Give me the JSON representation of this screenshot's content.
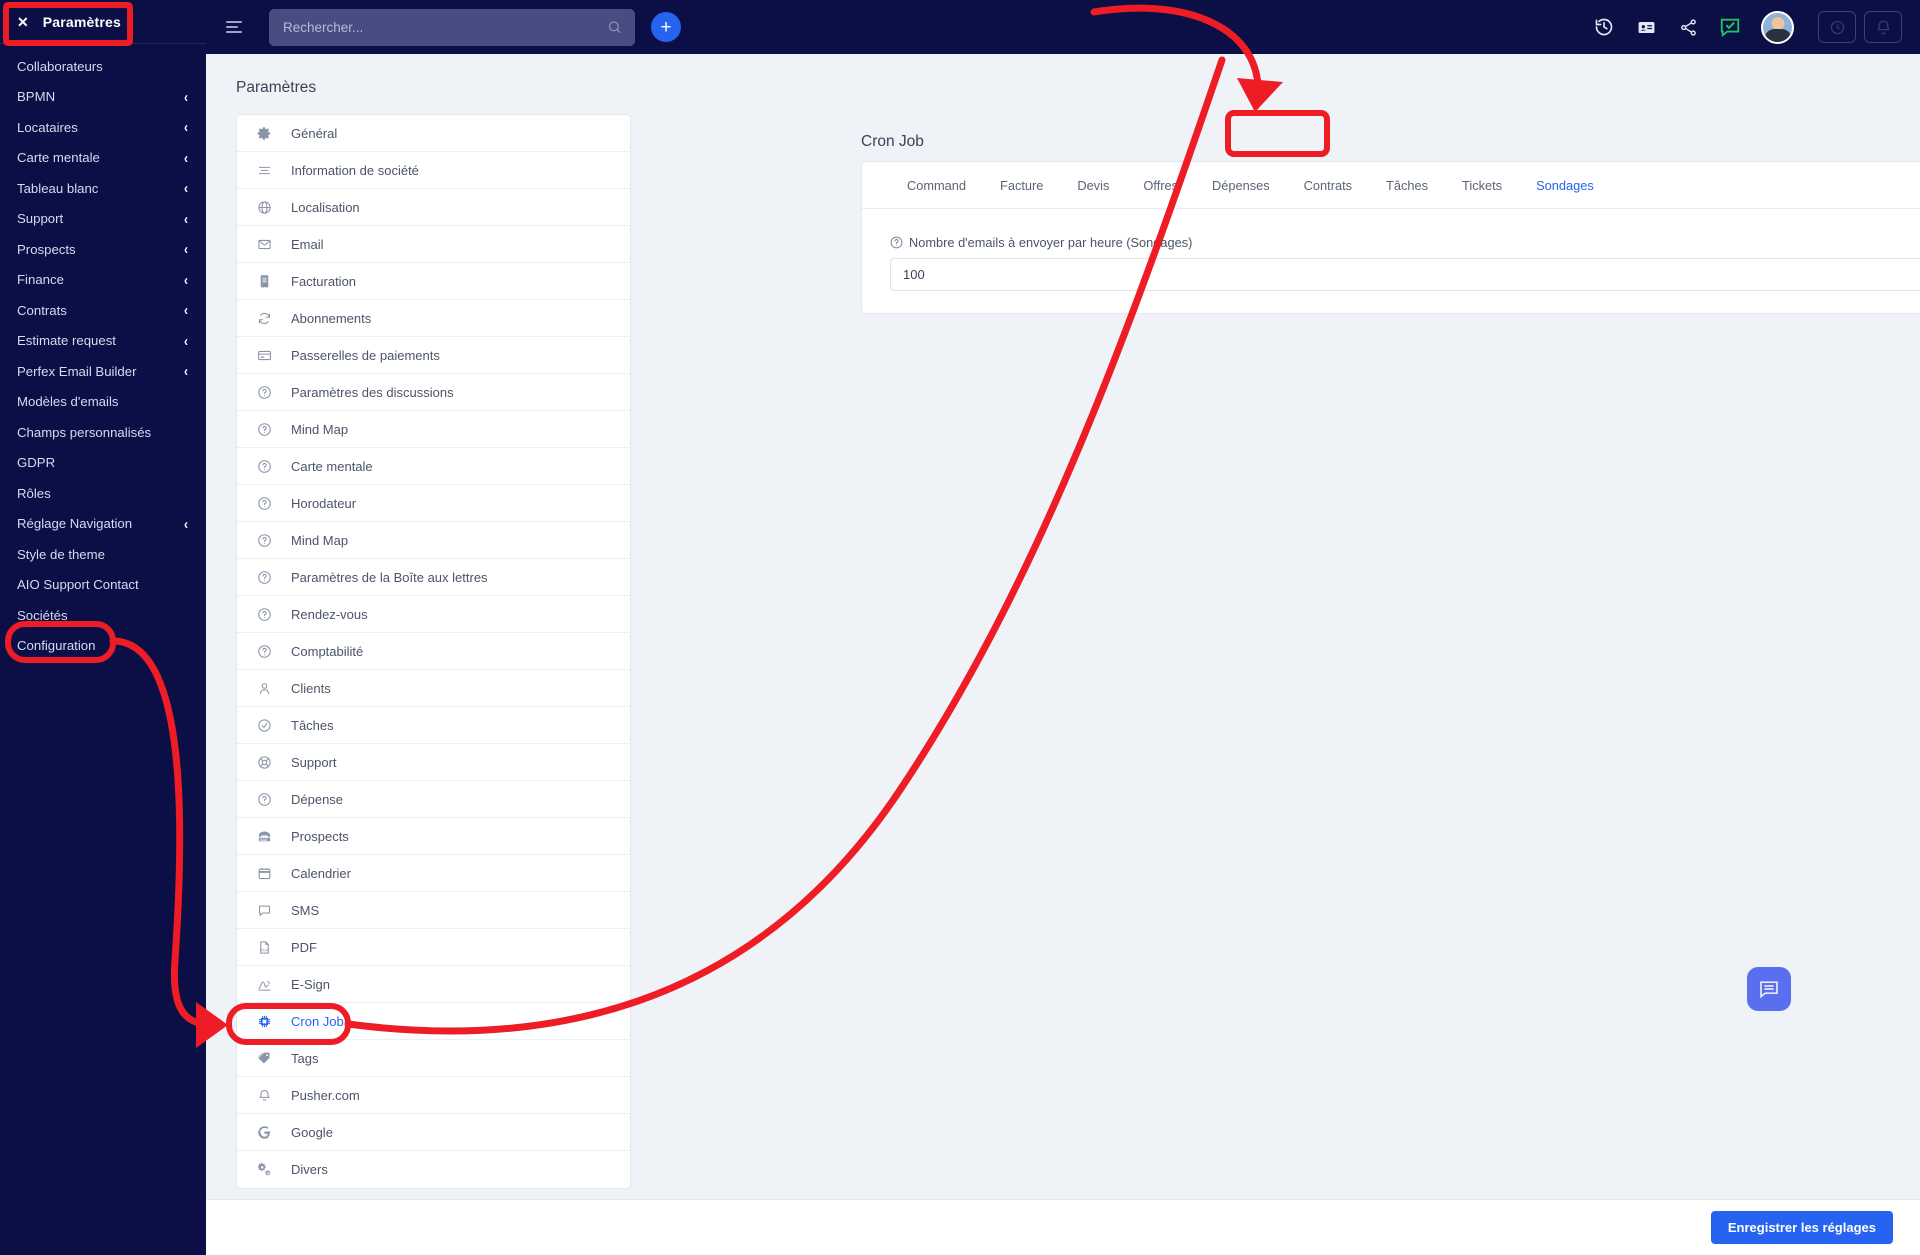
{
  "sidebar": {
    "header": {
      "close_icon": "close-icon",
      "title": "Paramètres"
    },
    "items": [
      {
        "label": "Collaborateurs",
        "expandable": false
      },
      {
        "label": "BPMN",
        "expandable": true
      },
      {
        "label": "Locataires",
        "expandable": true
      },
      {
        "label": "Carte mentale",
        "expandable": true
      },
      {
        "label": "Tableau blanc",
        "expandable": true
      },
      {
        "label": "Support",
        "expandable": true
      },
      {
        "label": "Prospects",
        "expandable": true
      },
      {
        "label": "Finance",
        "expandable": true
      },
      {
        "label": "Contrats",
        "expandable": true
      },
      {
        "label": "Estimate request",
        "expandable": true
      },
      {
        "label": "Perfex Email Builder",
        "expandable": true
      },
      {
        "label": "Modèles d'emails",
        "expandable": false
      },
      {
        "label": "Champs personnalisés",
        "expandable": false
      },
      {
        "label": "GDPR",
        "expandable": false
      },
      {
        "label": "Rôles",
        "expandable": false
      },
      {
        "label": "Réglage Navigation",
        "expandable": true
      },
      {
        "label": "Style de theme",
        "expandable": false
      },
      {
        "label": "AIO Support Contact",
        "expandable": false
      },
      {
        "label": "Sociétés",
        "expandable": false
      },
      {
        "label": "Configuration",
        "expandable": false,
        "highlighted": true
      }
    ]
  },
  "topbar": {
    "menu_icon": "hamburger-icon",
    "search": {
      "placeholder": "Rechercher...",
      "value": "",
      "icon": "search-icon"
    },
    "add_button_icon": "plus-icon",
    "icons": [
      "history-icon",
      "contact-card-icon",
      "share-icon",
      "chat-check-icon"
    ],
    "avatar": "user-avatar",
    "utility_buttons": [
      "clock-icon",
      "bell-icon"
    ]
  },
  "main": {
    "settings_heading": "Paramètres",
    "settings_list": [
      {
        "label": "Général",
        "icon": "gear-icon"
      },
      {
        "label": "Information de société",
        "icon": "lines-icon"
      },
      {
        "label": "Localisation",
        "icon": "globe-icon"
      },
      {
        "label": "Email",
        "icon": "envelope-icon"
      },
      {
        "label": "Facturation",
        "icon": "receipt-icon"
      },
      {
        "label": "Abonnements",
        "icon": "refresh-icon"
      },
      {
        "label": "Passerelles de paiements",
        "icon": "credit-card-icon"
      },
      {
        "label": "Paramètres des discussions",
        "icon": "question-circle-icon"
      },
      {
        "label": "Mind Map",
        "icon": "question-circle-icon"
      },
      {
        "label": "Carte mentale",
        "icon": "question-circle-icon"
      },
      {
        "label": "Horodateur",
        "icon": "question-circle-icon"
      },
      {
        "label": "Mind Map",
        "icon": "question-circle-icon"
      },
      {
        "label": "Paramètres de la Boîte aux lettres",
        "icon": "question-circle-icon"
      },
      {
        "label": "Rendez-vous",
        "icon": "question-circle-icon"
      },
      {
        "label": "Comptabilité",
        "icon": "question-circle-icon"
      },
      {
        "label": "Clients",
        "icon": "user-icon"
      },
      {
        "label": "Tâches",
        "icon": "check-circle-icon"
      },
      {
        "label": "Support",
        "icon": "lifebuoy-icon"
      },
      {
        "label": "Dépense",
        "icon": "question-circle-icon"
      },
      {
        "label": "Prospects",
        "icon": "phone-icon"
      },
      {
        "label": "Calendrier",
        "icon": "calendar-icon"
      },
      {
        "label": "SMS",
        "icon": "message-icon"
      },
      {
        "label": "PDF",
        "icon": "pdf-icon"
      },
      {
        "label": "E-Sign",
        "icon": "signature-icon"
      },
      {
        "label": "Cron Job",
        "icon": "chip-icon",
        "active": true
      },
      {
        "label": "Tags",
        "icon": "tag-icon"
      },
      {
        "label": "Pusher.com",
        "icon": "bell-icon"
      },
      {
        "label": "Google",
        "icon": "google-icon"
      },
      {
        "label": "Divers",
        "icon": "gears-icon"
      }
    ],
    "panel": {
      "title": "Cron Job",
      "tabs": [
        {
          "label": "Command",
          "active": false
        },
        {
          "label": "Facture",
          "active": false
        },
        {
          "label": "Devis",
          "active": false
        },
        {
          "label": "Offres",
          "active": false
        },
        {
          "label": "Dépenses",
          "active": false
        },
        {
          "label": "Contrats",
          "active": false
        },
        {
          "label": "Tâches",
          "active": false
        },
        {
          "label": "Tickets",
          "active": false
        },
        {
          "label": "Sondages",
          "active": true
        }
      ],
      "field": {
        "help_icon": "question-circle-icon",
        "label": "Nombre d'emails à envoyer par heure (Sondages)",
        "value": "100",
        "placeholder": ""
      }
    }
  },
  "footer": {
    "save_label": "Enregistrer les réglages"
  },
  "chat_fab": {
    "icon": "chat-bubble-icon"
  },
  "colors": {
    "sidebar_bg": "#0b0f45",
    "accent": "#2563f0",
    "page_bg": "#eff2f7",
    "annotation_red": "#ee1c25",
    "fab": "#5a6ef0"
  }
}
